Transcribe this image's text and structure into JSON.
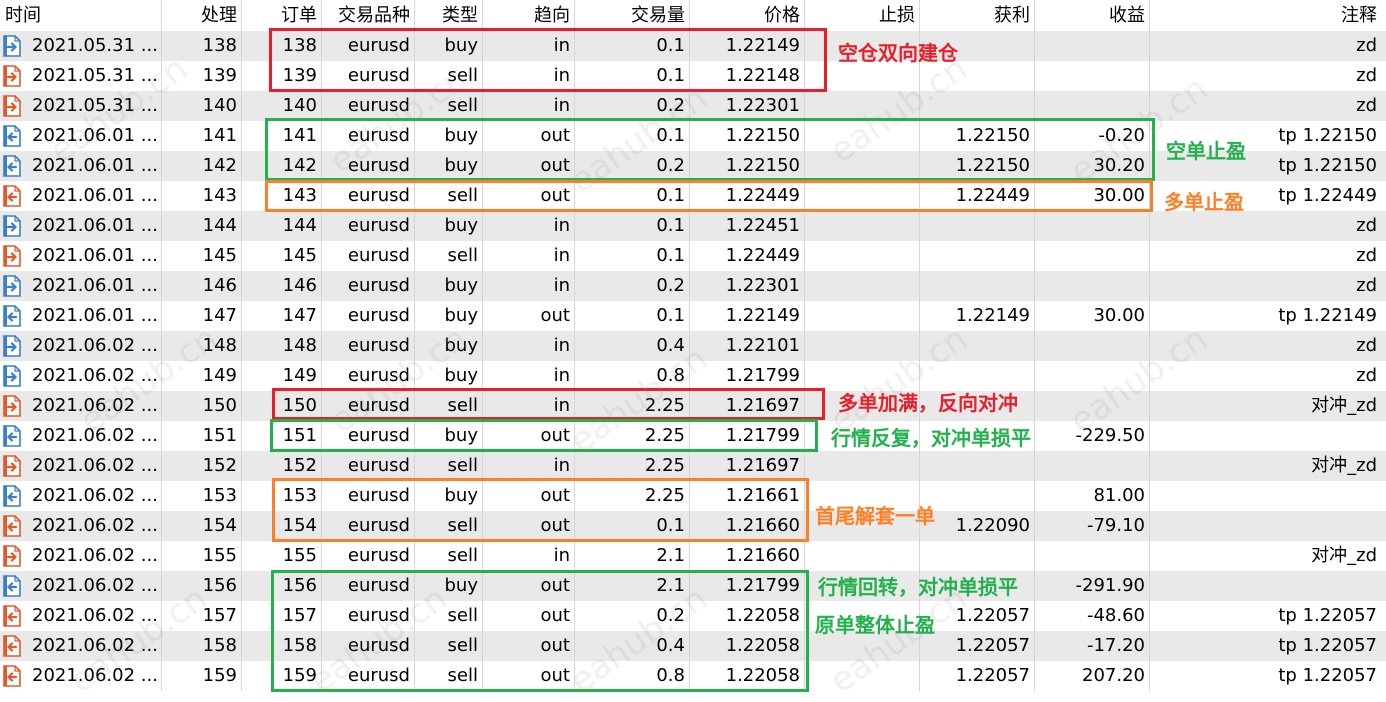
{
  "colors": {
    "buy_icon": "#3a7fc8",
    "sell_icon": "#e25a2c",
    "box_red": "#e81e2a",
    "box_green": "#22b14c",
    "box_orange": "#ff7f27"
  },
  "columns": [
    "时间",
    "处理",
    "订单",
    "交易品种",
    "类型",
    "趋向",
    "交易量",
    "价格",
    "止损",
    "获利",
    "收益",
    "注释"
  ],
  "rows": [
    {
      "time": "2021.05.31 ...",
      "deal": "138",
      "order": "138",
      "symbol": "eurusd",
      "type": "buy",
      "dir": "in",
      "vol": "0.1",
      "price": "1.22149",
      "sl": "",
      "tp": "",
      "profit": "",
      "comment": "zd",
      "icon": "buy-in-icon"
    },
    {
      "time": "2021.05.31 ...",
      "deal": "139",
      "order": "139",
      "symbol": "eurusd",
      "type": "sell",
      "dir": "in",
      "vol": "0.1",
      "price": "1.22148",
      "sl": "",
      "tp": "",
      "profit": "",
      "comment": "zd",
      "icon": "sell-in-icon"
    },
    {
      "time": "2021.05.31 ...",
      "deal": "140",
      "order": "140",
      "symbol": "eurusd",
      "type": "sell",
      "dir": "in",
      "vol": "0.2",
      "price": "1.22301",
      "sl": "",
      "tp": "",
      "profit": "",
      "comment": "zd",
      "icon": "sell-in-icon"
    },
    {
      "time": "2021.06.01 ...",
      "deal": "141",
      "order": "141",
      "symbol": "eurusd",
      "type": "buy",
      "dir": "out",
      "vol": "0.1",
      "price": "1.22150",
      "sl": "",
      "tp": "1.22150",
      "profit": "-0.20",
      "comment": "tp 1.22150",
      "icon": "buy-out-icon"
    },
    {
      "time": "2021.06.01 ...",
      "deal": "142",
      "order": "142",
      "symbol": "eurusd",
      "type": "buy",
      "dir": "out",
      "vol": "0.2",
      "price": "1.22150",
      "sl": "",
      "tp": "1.22150",
      "profit": "30.20",
      "comment": "tp 1.22150",
      "icon": "buy-out-icon"
    },
    {
      "time": "2021.06.01 ...",
      "deal": "143",
      "order": "143",
      "symbol": "eurusd",
      "type": "sell",
      "dir": "out",
      "vol": "0.1",
      "price": "1.22449",
      "sl": "",
      "tp": "1.22449",
      "profit": "30.00",
      "comment": "tp 1.22449",
      "icon": "sell-out-icon"
    },
    {
      "time": "2021.06.01 ...",
      "deal": "144",
      "order": "144",
      "symbol": "eurusd",
      "type": "buy",
      "dir": "in",
      "vol": "0.1",
      "price": "1.22451",
      "sl": "",
      "tp": "",
      "profit": "",
      "comment": "zd",
      "icon": "buy-in-icon"
    },
    {
      "time": "2021.06.01 ...",
      "deal": "145",
      "order": "145",
      "symbol": "eurusd",
      "type": "sell",
      "dir": "in",
      "vol": "0.1",
      "price": "1.22449",
      "sl": "",
      "tp": "",
      "profit": "",
      "comment": "zd",
      "icon": "sell-in-icon"
    },
    {
      "time": "2021.06.01 ...",
      "deal": "146",
      "order": "146",
      "symbol": "eurusd",
      "type": "buy",
      "dir": "in",
      "vol": "0.2",
      "price": "1.22301",
      "sl": "",
      "tp": "",
      "profit": "",
      "comment": "zd",
      "icon": "buy-in-icon"
    },
    {
      "time": "2021.06.01 ...",
      "deal": "147",
      "order": "147",
      "symbol": "eurusd",
      "type": "buy",
      "dir": "out",
      "vol": "0.1",
      "price": "1.22149",
      "sl": "",
      "tp": "1.22149",
      "profit": "30.00",
      "comment": "tp 1.22149",
      "icon": "buy-out-icon"
    },
    {
      "time": "2021.06.02 ...",
      "deal": "148",
      "order": "148",
      "symbol": "eurusd",
      "type": "buy",
      "dir": "in",
      "vol": "0.4",
      "price": "1.22101",
      "sl": "",
      "tp": "",
      "profit": "",
      "comment": "zd",
      "icon": "buy-in-icon"
    },
    {
      "time": "2021.06.02 ...",
      "deal": "149",
      "order": "149",
      "symbol": "eurusd",
      "type": "buy",
      "dir": "in",
      "vol": "0.8",
      "price": "1.21799",
      "sl": "",
      "tp": "",
      "profit": "",
      "comment": "zd",
      "icon": "buy-in-icon"
    },
    {
      "time": "2021.06.02 ...",
      "deal": "150",
      "order": "150",
      "symbol": "eurusd",
      "type": "sell",
      "dir": "in",
      "vol": "2.25",
      "price": "1.21697",
      "sl": "",
      "tp": "",
      "profit": "",
      "comment": "对冲_zd",
      "icon": "sell-in-icon"
    },
    {
      "time": "2021.06.02 ...",
      "deal": "151",
      "order": "151",
      "symbol": "eurusd",
      "type": "buy",
      "dir": "out",
      "vol": "2.25",
      "price": "1.21799",
      "sl": "",
      "tp": "",
      "profit": "-229.50",
      "comment": "",
      "icon": "buy-out-icon"
    },
    {
      "time": "2021.06.02 ...",
      "deal": "152",
      "order": "152",
      "symbol": "eurusd",
      "type": "sell",
      "dir": "in",
      "vol": "2.25",
      "price": "1.21697",
      "sl": "",
      "tp": "",
      "profit": "",
      "comment": "对冲_zd",
      "icon": "sell-in-icon"
    },
    {
      "time": "2021.06.02 ...",
      "deal": "153",
      "order": "153",
      "symbol": "eurusd",
      "type": "buy",
      "dir": "out",
      "vol": "2.25",
      "price": "1.21661",
      "sl": "",
      "tp": "",
      "profit": "81.00",
      "comment": "",
      "icon": "buy-out-icon"
    },
    {
      "time": "2021.06.02 ...",
      "deal": "154",
      "order": "154",
      "symbol": "eurusd",
      "type": "sell",
      "dir": "out",
      "vol": "0.1",
      "price": "1.21660",
      "sl": "",
      "tp": "1.22090",
      "profit": "-79.10",
      "comment": "",
      "icon": "sell-out-icon"
    },
    {
      "time": "2021.06.02 ...",
      "deal": "155",
      "order": "155",
      "symbol": "eurusd",
      "type": "sell",
      "dir": "in",
      "vol": "2.1",
      "price": "1.21660",
      "sl": "",
      "tp": "",
      "profit": "",
      "comment": "对冲_zd",
      "icon": "sell-in-icon"
    },
    {
      "time": "2021.06.02 ...",
      "deal": "156",
      "order": "156",
      "symbol": "eurusd",
      "type": "buy",
      "dir": "out",
      "vol": "2.1",
      "price": "1.21799",
      "sl": "",
      "tp": "",
      "profit": "-291.90",
      "comment": "",
      "icon": "buy-out-icon"
    },
    {
      "time": "2021.06.02 ...",
      "deal": "157",
      "order": "157",
      "symbol": "eurusd",
      "type": "sell",
      "dir": "out",
      "vol": "0.2",
      "price": "1.22058",
      "sl": "",
      "tp": "1.22057",
      "profit": "-48.60",
      "comment": "tp 1.22057",
      "icon": "sell-out-icon"
    },
    {
      "time": "2021.06.02 ...",
      "deal": "158",
      "order": "158",
      "symbol": "eurusd",
      "type": "sell",
      "dir": "out",
      "vol": "0.4",
      "price": "1.22058",
      "sl": "",
      "tp": "1.22057",
      "profit": "-17.20",
      "comment": "tp 1.22057",
      "icon": "sell-out-icon"
    },
    {
      "time": "2021.06.02 ...",
      "deal": "159",
      "order": "159",
      "symbol": "eurusd",
      "type": "sell",
      "dir": "out",
      "vol": "0.8",
      "price": "1.22058",
      "sl": "",
      "tp": "1.22057",
      "profit": "207.20",
      "comment": "tp 1.22057",
      "icon": "sell-out-icon"
    }
  ],
  "annotations": [
    {
      "text": "空仓双向建仓",
      "color": "#e81e2a"
    },
    {
      "text": "空单止盈",
      "color": "#22b14c"
    },
    {
      "text": "多单止盈",
      "color": "#ff7f27"
    },
    {
      "text": "多单加满，反向对冲",
      "color": "#e81e2a"
    },
    {
      "text": "行情反复，对冲单损平",
      "color": "#22b14c"
    },
    {
      "text": "首尾解套一单",
      "color": "#ff7f27"
    },
    {
      "text": "行情回转，对冲单损平",
      "color": "#22b14c"
    },
    {
      "text": "原单整体止盈",
      "color": "#22b14c"
    }
  ],
  "watermark": "eahub.cn"
}
